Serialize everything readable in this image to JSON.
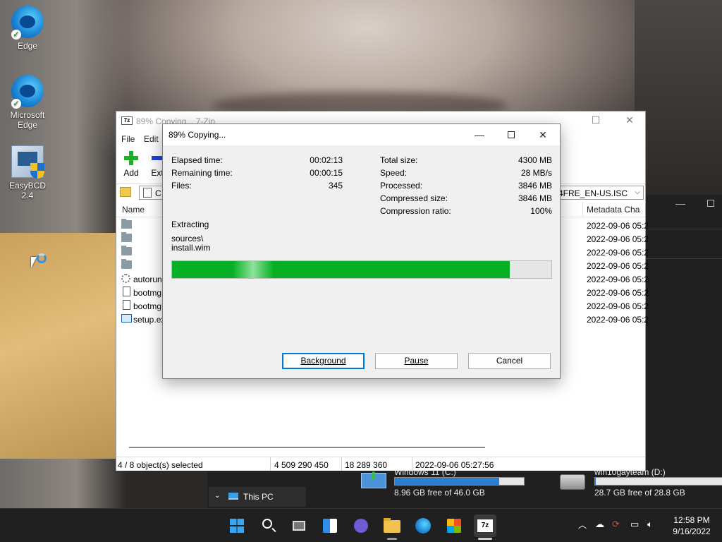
{
  "desktop": {
    "icons": [
      {
        "label": "Edge"
      },
      {
        "label": "Microsoft Edge"
      },
      {
        "label": "EasyBCD 2.4"
      }
    ]
  },
  "main_window": {
    "title": "89% Copying... 7-Zip",
    "menu": [
      "File",
      "Edit"
    ],
    "toolbar": {
      "add_label": "Add",
      "extract_label": "Extr"
    },
    "address": {
      "path_start": "C",
      "path_end": "_X64FRE_EN-US.ISC"
    },
    "columns": {
      "name": "Name",
      "modified": "Metadata Cha"
    },
    "files": [
      {
        "name": "",
        "type": "folder",
        "date": "2022-09-06 05:2"
      },
      {
        "name": "",
        "type": "folder",
        "date": "2022-09-06 05:2"
      },
      {
        "name": "",
        "type": "folder",
        "date": "2022-09-06 05:2"
      },
      {
        "name": "",
        "type": "folder",
        "date": "2022-09-06 05:2"
      },
      {
        "name": "autorun",
        "type": "gear",
        "date": "2022-09-06 05:2"
      },
      {
        "name": "bootmg",
        "type": "file",
        "date": "2022-09-06 05:2"
      },
      {
        "name": "bootmg",
        "type": "file",
        "date": "2022-09-06 05:2"
      },
      {
        "name": "setup.ex",
        "type": "setup",
        "date": "2022-09-06 05:2"
      }
    ],
    "status": {
      "selected": "4 / 8 object(s) selected",
      "size": "4 509 290 450",
      "packed": "18 289 360",
      "modified": "2022-09-06 05:27:56"
    }
  },
  "dialog": {
    "title": "89% Copying...",
    "left_stats": [
      {
        "label": "Elapsed time:",
        "value": "00:02:13"
      },
      {
        "label": "Remaining time:",
        "value": "00:00:15"
      },
      {
        "label": "Files:",
        "value": "345"
      }
    ],
    "right_stats": [
      {
        "label": "Total size:",
        "value": "4300 MB"
      },
      {
        "label": "Speed:",
        "value": "28 MB/s"
      },
      {
        "label": "Processed:",
        "value": "3846 MB"
      },
      {
        "label": "Compressed size:",
        "value": "3846 MB"
      },
      {
        "label": "Compression ratio:",
        "value": "100%"
      }
    ],
    "operation": "Extracting",
    "current_folder": "sources\\",
    "current_file": "install.wim",
    "progress_fraction": 0.89,
    "buttons": {
      "background": "Background",
      "pause": "Pause",
      "cancel": "Cancel"
    },
    "accent_color": "#06b025"
  },
  "explorer": {
    "nav_item": "This PC",
    "drives": [
      {
        "name": "Windows 11 (C:)",
        "free": "8.96 GB free of 46.0 GB",
        "used_fraction": 0.81
      },
      {
        "name": "win10gayteam (D:)",
        "free": "28.7 GB free of 28.8 GB",
        "used_fraction": 0.004
      }
    ]
  },
  "taskbar": {
    "time": "12:58 PM",
    "date": "9/16/2022",
    "apps": [
      "start-icon",
      "search-icon",
      "task-view-icon",
      "widgets-icon",
      "chat-icon",
      "file-explorer-icon",
      "edge-icon",
      "store-icon",
      "7zip-icon"
    ]
  }
}
